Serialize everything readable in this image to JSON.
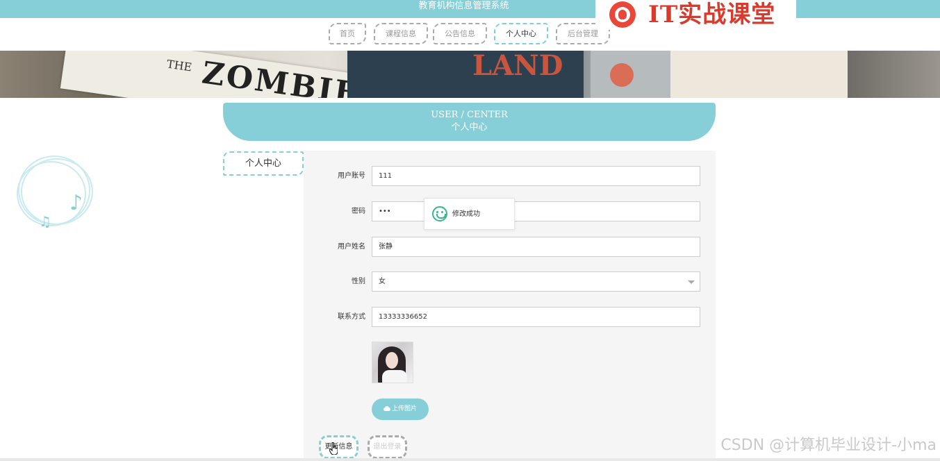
{
  "app": {
    "title": "教育机构信息管理系统"
  },
  "nav": {
    "items": [
      {
        "label": "首页"
      },
      {
        "label": "课程信息"
      },
      {
        "label": "公告信息"
      },
      {
        "label": "个人中心"
      },
      {
        "label": "后台管理"
      }
    ],
    "active": "个人中心"
  },
  "watermark_logo": {
    "text": "IT实战课堂"
  },
  "banner": {
    "text_small": "THE",
    "text_large": "ZOMBIE",
    "text_right": "LAND"
  },
  "section": {
    "title_en": "USER / CENTER",
    "title_cn": "个人中心"
  },
  "sidebar": {
    "items": [
      {
        "label": "个人中心"
      }
    ]
  },
  "form": {
    "fields": [
      {
        "label": "用户账号",
        "value": "111"
      },
      {
        "label": "密码",
        "value": "•••"
      },
      {
        "label": "用户姓名",
        "value": "张静"
      },
      {
        "label": "性别",
        "value": "女"
      },
      {
        "label": "联系方式",
        "value": "13333336652"
      }
    ],
    "upload_label": "上传图片",
    "update_label": "更新信息",
    "logout_label": "退出登录"
  },
  "toast": {
    "message": "修改成功"
  },
  "footer_watermark": {
    "text": "CSDN @计算机毕业设计-小ma"
  },
  "colors": {
    "accent": "#86cfd8",
    "success": "#3ab58e",
    "logo_red": "#d83a2c"
  }
}
